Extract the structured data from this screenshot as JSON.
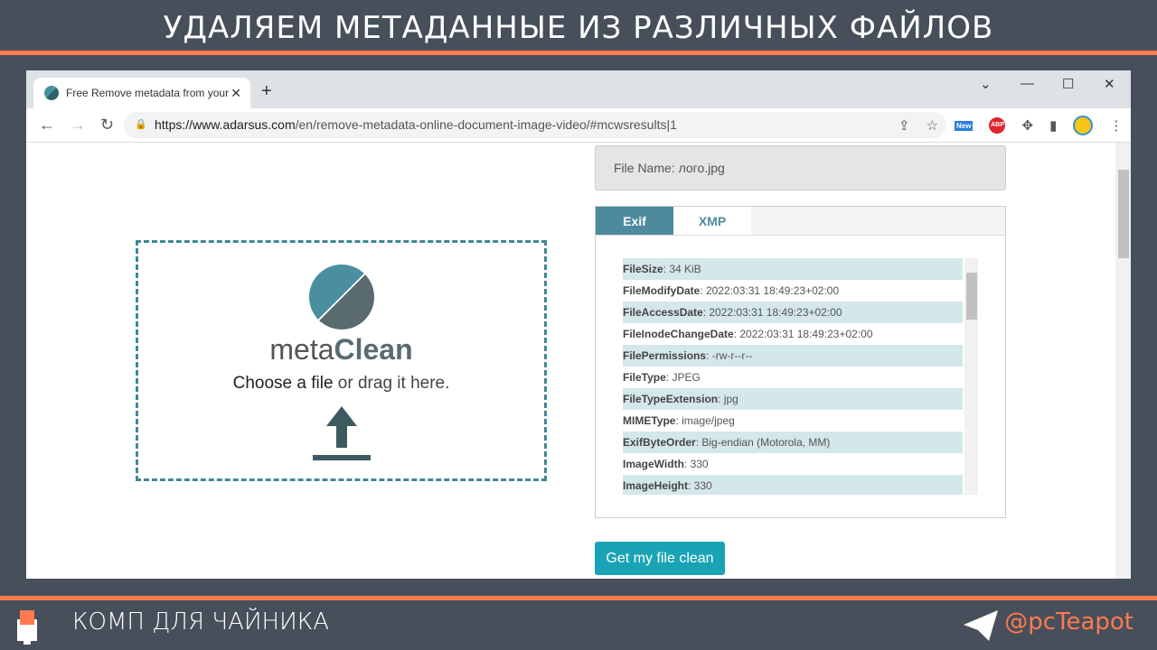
{
  "banner": {
    "title": "УДАЛЯЕМ МЕТАДАННЫЕ ИЗ РАЗЛИЧНЫХ ФАЙЛОВ"
  },
  "browser": {
    "tab_title": "Free Remove metadata from your",
    "url_host": "https://www.adarsus.com",
    "url_path": "/en/remove-metadata-online-document-image-video/#mcwsresults|1",
    "new_badge": "New",
    "abp": "ABP"
  },
  "upload": {
    "brand_light": "meta",
    "brand_bold": "Clean",
    "choose_bold": "Choose a file",
    "choose_rest": " or drag it here."
  },
  "file": {
    "name": "File Name: лого.jpg"
  },
  "tabs": [
    "Exif",
    "XMP"
  ],
  "metadata": [
    {
      "k": "FileSize",
      "v": ": 34 KiB"
    },
    {
      "k": "FileModifyDate",
      "v": ": 2022:03:31 18:49:23+02:00"
    },
    {
      "k": "FileAccessDate",
      "v": ": 2022:03:31 18:49:23+02:00"
    },
    {
      "k": "FileInodeChangeDate",
      "v": ": 2022:03:31 18:49:23+02:00"
    },
    {
      "k": "FilePermissions",
      "v": ": -rw-r--r--"
    },
    {
      "k": "FileType",
      "v": ": JPEG"
    },
    {
      "k": "FileTypeExtension",
      "v": ": jpg"
    },
    {
      "k": "MIMEType",
      "v": ": image/jpeg"
    },
    {
      "k": "ExifByteOrder",
      "v": ": Big-endian (Motorola, MM)"
    },
    {
      "k": "ImageWidth",
      "v": ": 330"
    },
    {
      "k": "ImageHeight",
      "v": ": 330"
    }
  ],
  "button": {
    "clean": "Get my file clean"
  },
  "footer": {
    "channel": "КОМП ДЛЯ ЧАЙНИКА",
    "handle": "@pcTeapot"
  }
}
